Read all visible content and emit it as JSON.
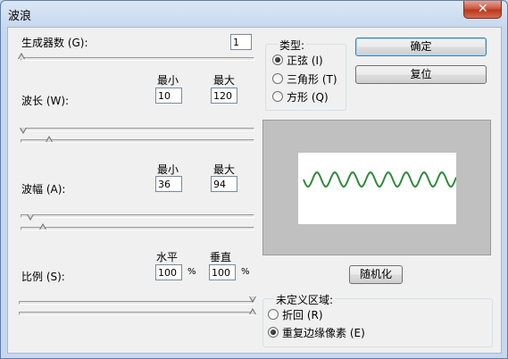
{
  "window": {
    "title": "波浪"
  },
  "generators": {
    "label": "生成器数 (G):",
    "value": "1"
  },
  "headers": {
    "min": "最小",
    "max": "最大",
    "horizontal": "水平",
    "vertical": "垂直",
    "percent": "%"
  },
  "wavelength": {
    "label": "波长 (W):",
    "min": "10",
    "max": "120"
  },
  "amplitude": {
    "label": "波幅 (A):",
    "min": "36",
    "max": "94"
  },
  "scale": {
    "label": "比例 (S):",
    "horizontal": "100",
    "vertical": "100"
  },
  "type_group": {
    "title": "类型:",
    "options": [
      {
        "label": "正弦 (I)",
        "selected": true
      },
      {
        "label": "三角形 (T)",
        "selected": false
      },
      {
        "label": "方形 (Q)",
        "selected": false
      }
    ]
  },
  "buttons": {
    "ok": "确定",
    "reset": "复位",
    "randomize": "随机化"
  },
  "undefined_areas": {
    "title": "未定义区域:",
    "options": [
      {
        "label": "折回 (R)",
        "selected": false
      },
      {
        "label": "重复边缘像素 (E)",
        "selected": true
      }
    ]
  },
  "colors": {
    "wave": "#2e8b3a",
    "accent": "#3c7fb1"
  },
  "icons": {
    "close": "close-icon"
  }
}
